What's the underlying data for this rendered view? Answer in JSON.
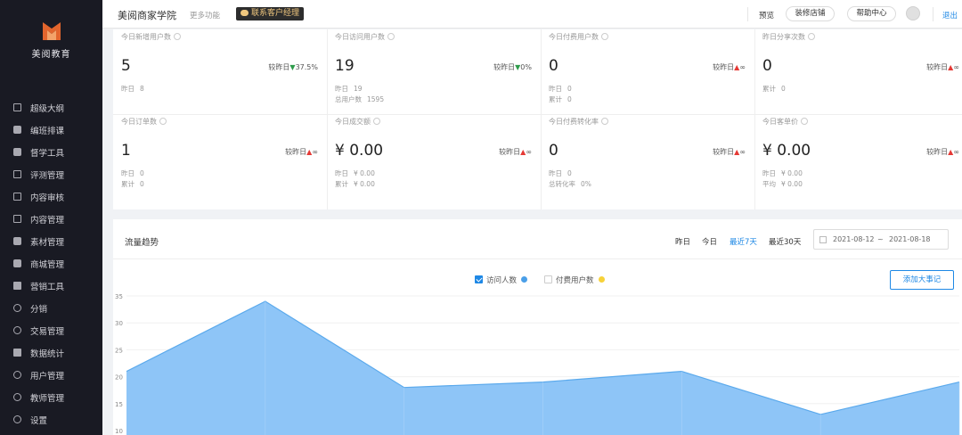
{
  "sidebar": {
    "brand": "美阅教育",
    "items": [
      {
        "label": "超级大纲",
        "icon": "outline-icon"
      },
      {
        "label": "编班排课",
        "icon": "schedule-icon"
      },
      {
        "label": "督学工具",
        "icon": "toolbox-icon"
      },
      {
        "label": "评测管理",
        "icon": "exam-icon"
      },
      {
        "label": "内容审核",
        "icon": "review-icon"
      },
      {
        "label": "内容管理",
        "icon": "content-icon"
      },
      {
        "label": "素材管理",
        "icon": "material-icon"
      },
      {
        "label": "商城管理",
        "icon": "shop-icon"
      },
      {
        "label": "营销工具",
        "icon": "marketing-icon"
      },
      {
        "label": "分销",
        "icon": "distribution-icon"
      },
      {
        "label": "交易管理",
        "icon": "trade-icon"
      },
      {
        "label": "数据统计",
        "icon": "stats-icon"
      },
      {
        "label": "用户管理",
        "icon": "users-icon"
      },
      {
        "label": "教师管理",
        "icon": "teacher-icon"
      },
      {
        "label": "设置",
        "icon": "gear-icon"
      }
    ]
  },
  "header": {
    "title": "美阅商家学院",
    "more": "更多功能",
    "contact": "联系客户经理",
    "preview": "预览",
    "decorate": "装修店铺",
    "help": "帮助中心",
    "logout": "退出"
  },
  "stats": [
    {
      "label": "今日新增用户数",
      "value": "5",
      "compare": "较昨日",
      "trend": "down",
      "arrow": "▼",
      "change": "37.5%",
      "subs": [
        [
          "昨日",
          "8"
        ]
      ]
    },
    {
      "label": "今日访问用户数",
      "value": "19",
      "compare": "较昨日",
      "trend": "down",
      "arrow": "▼",
      "change": "0%",
      "subs": [
        [
          "昨日",
          "19"
        ],
        [
          "总用户数",
          "1595"
        ]
      ]
    },
    {
      "label": "今日付费用户数",
      "value": "0",
      "compare": "较昨日",
      "trend": "up",
      "arrow": "▲",
      "change": "∞",
      "subs": [
        [
          "昨日",
          "0"
        ],
        [
          "累计",
          "0"
        ]
      ]
    },
    {
      "label": "昨日分享次数",
      "value": "0",
      "compare": "较昨日",
      "trend": "up",
      "arrow": "▲",
      "change": "∞",
      "subs": [
        [
          "累计",
          "0"
        ]
      ]
    },
    {
      "label": "今日订单数",
      "value": "1",
      "compare": "较昨日",
      "trend": "up",
      "arrow": "▲",
      "change": "∞",
      "subs": [
        [
          "昨日",
          "0"
        ],
        [
          "累计",
          "0"
        ]
      ]
    },
    {
      "label": "今日成交额",
      "value": "¥ 0.00",
      "compare": "较昨日",
      "trend": "up",
      "arrow": "▲",
      "change": "∞",
      "subs": [
        [
          "昨日",
          "¥ 0.00"
        ],
        [
          "累计",
          "¥ 0.00"
        ]
      ]
    },
    {
      "label": "今日付费转化率",
      "value": "0",
      "compare": "较昨日",
      "trend": "up",
      "arrow": "▲",
      "change": "∞",
      "subs": [
        [
          "昨日",
          "0"
        ],
        [
          "总转化率",
          "0%"
        ]
      ]
    },
    {
      "label": "今日客单价",
      "value": "¥ 0.00",
      "compare": "较昨日",
      "trend": "up",
      "arrow": "▲",
      "change": "∞",
      "subs": [
        [
          "昨日",
          "¥ 0.00"
        ],
        [
          "平均",
          "¥ 0.00"
        ]
      ]
    }
  ],
  "trend": {
    "title": "流量趋势",
    "ranges": [
      "昨日",
      "今日",
      "最近7天",
      "最近30天"
    ],
    "active_range": "最近7天",
    "date_start": "2021-08-12",
    "date_sep": "~",
    "date_end": "2021-08-18",
    "add_event": "添加大事记"
  },
  "colors": {
    "sidebar_bg": "#191a23",
    "accent": "#1e88e5",
    "area_fill": "#8ec5f7",
    "area_line": "#5aa9ec",
    "paid_dot": "#f7d239",
    "up": "#e53935",
    "down": "#2e9c4b"
  },
  "chart_data": {
    "type": "area",
    "series": [
      {
        "name": "访问人数",
        "values": [
          21,
          34,
          18,
          19,
          21,
          13,
          19
        ],
        "color": "#8ec5f7",
        "checked": true
      },
      {
        "name": "付费用户数",
        "values": [],
        "color": "#f7d239",
        "checked": false
      }
    ],
    "y_ticks": [
      10,
      15,
      20,
      25,
      30,
      35
    ],
    "ylim": [
      10,
      35
    ]
  }
}
